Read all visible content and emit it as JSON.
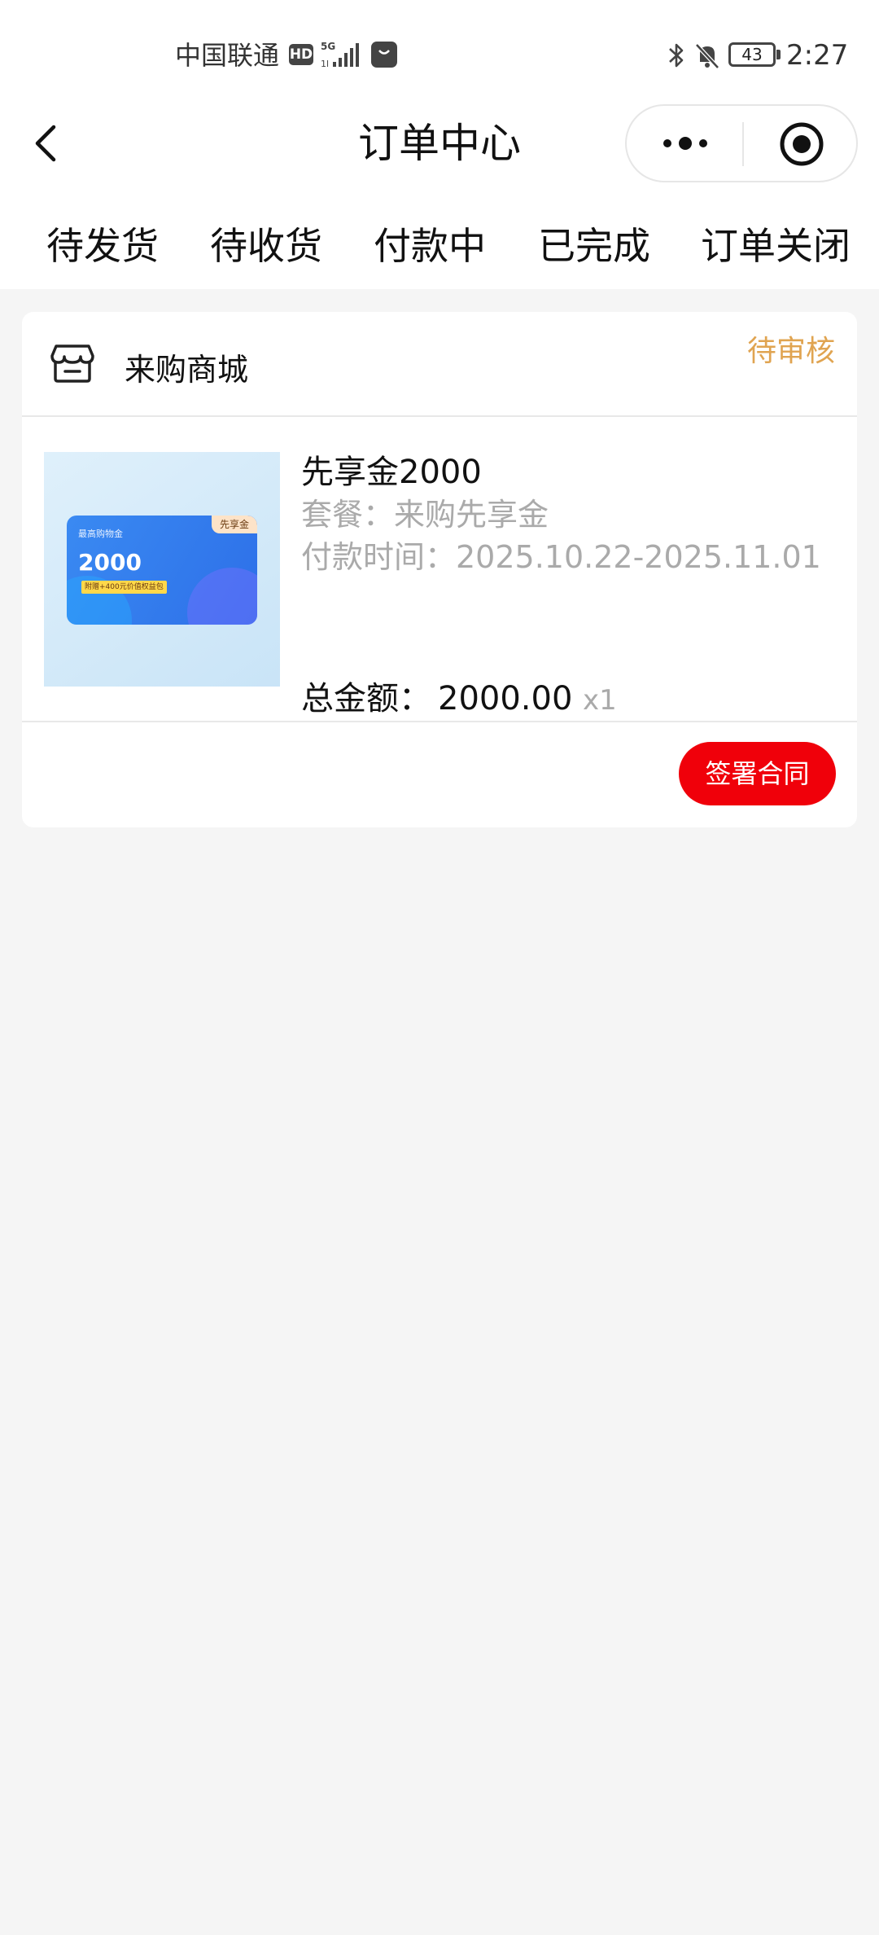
{
  "status_bar": {
    "carrier": "中国联通",
    "hd": "HD",
    "network": "5G",
    "battery": "43",
    "time": "2:27"
  },
  "nav": {
    "title": "订单中心"
  },
  "tabs": [
    {
      "label": "待发货"
    },
    {
      "label": "待收货"
    },
    {
      "label": "付款中"
    },
    {
      "label": "已完成"
    },
    {
      "label": "订单关闭"
    }
  ],
  "order": {
    "store_name": "来购商城",
    "status": "待审核",
    "product": {
      "name": "先享金2000",
      "package": "套餐：来购先享金",
      "payment_time": "付款时间：2025.10.22-2025.11.01",
      "image": {
        "tag": "先享金",
        "head": "最高购物金",
        "amount": "2000",
        "note": "附赠+400元价值权益包"
      }
    },
    "total_label": "总金额：",
    "total_value": "2000.00",
    "quantity": "x1",
    "action_label": "签署合同"
  },
  "colors": {
    "status": "#e0a451",
    "action_button": "#f0000a",
    "page_background": "#f5f5f5"
  }
}
